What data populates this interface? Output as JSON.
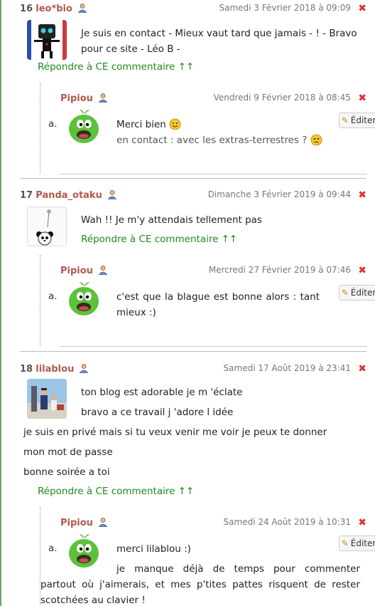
{
  "icons": {
    "user": "user-icon",
    "delete": "close-icon",
    "edit": "pencil-icon"
  },
  "colors": {
    "author": "#b15a4e",
    "link": "#1d8a1d",
    "delete": "#d33333",
    "rule": "#6aa56a"
  },
  "comments": [
    {
      "number": "16",
      "author": "leo*bio",
      "date": "Samedi 3 Février 2018 à 09:09",
      "delete_label": "✖",
      "lines": [
        "Je suis en contact - Mieux vaut tard que jamais - ! - Bravo pour ce site - Léo B -"
      ],
      "reply_label": "Répondre à CE commentaire ↑↑",
      "reply": {
        "letter": "a.",
        "author": "Pipiou",
        "date": "Vendredi 9 Février 2018 à 08:45",
        "delete_label": "✖",
        "edit_label": "Éditer",
        "line1": "Merci bien",
        "line2": "en contact : avec les extras-terrestres ?"
      }
    },
    {
      "number": "17",
      "author": "Panda_otaku",
      "date": "Dimanche 3 Février 2019 à 09:44",
      "delete_label": "✖",
      "lines": [
        "Wah !! Je m'y attendais tellement pas"
      ],
      "reply_label": "Répondre à CE commentaire ↑↑",
      "reply": {
        "letter": "a.",
        "author": "Pipiou",
        "date": "Mercredi 27 Février 2019 à 07:46",
        "delete_label": "✖",
        "edit_label": "Éditer",
        "line1": "c'est que la blague est bonne alors : tant mieux :)"
      }
    },
    {
      "number": "18",
      "author": "lilablou",
      "date": "Samedi 17 Août 2019 à 23:41",
      "delete_label": "✖",
      "lines": [
        "ton blog est adorable je m 'éclate",
        "bravo a ce travail j 'adore l idée",
        "je suis en privé mais si tu veux venir me voir je peux te donner",
        "mon mot de passe",
        "bonne soirée a toi"
      ],
      "reply_label": "Répondre à CE commentaire ↑↑",
      "reply": {
        "letter": "a.",
        "author": "Pipiou",
        "date": "Samedi 24 Août 2019 à 10:31",
        "delete_label": "✖",
        "edit_label": "Éditer",
        "line1": "merci lilablou :)",
        "line2": "je manque déjà de temps pour commenter partout où j'aimerais, et mes p'tites pattes risquent de rester scotchées au clavier !"
      }
    }
  ]
}
